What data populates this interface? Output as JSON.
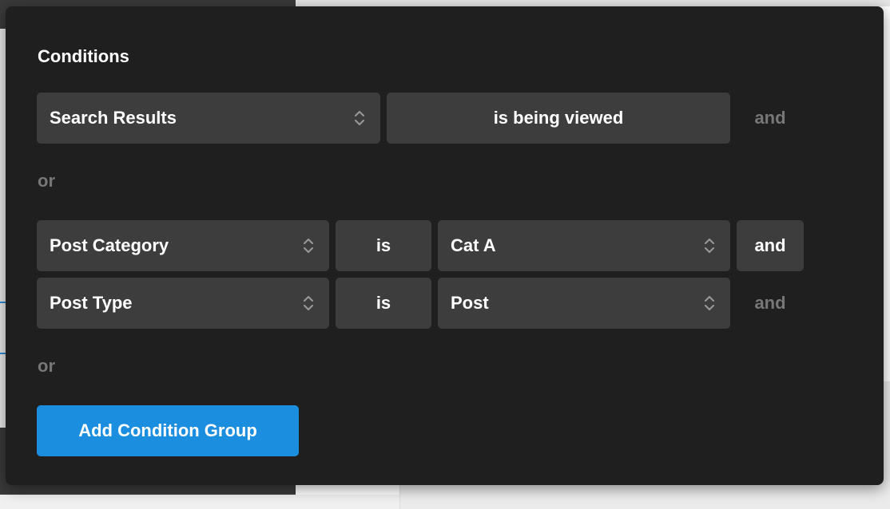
{
  "modal": {
    "title": "Conditions"
  },
  "groups": [
    {
      "rows": [
        {
          "subject": "Search Results",
          "operator": "is being viewed",
          "connector": "and",
          "connector_active": false
        }
      ]
    },
    {
      "rows": [
        {
          "subject": "Post Category",
          "operator": "is",
          "value": "Cat A",
          "connector": "and",
          "connector_active": true
        },
        {
          "subject": "Post Type",
          "operator": "is",
          "value": "Post",
          "connector": "and",
          "connector_active": false
        }
      ]
    }
  ],
  "separators": {
    "or_1": "or",
    "or_2": "or"
  },
  "actions": {
    "add_condition_group": "Add Condition Group"
  },
  "icons": {
    "select_chevron": "chevron-up-down-icon"
  },
  "colors": {
    "modal_bg": "#1f1f1f",
    "control_bg": "#3d3d3d",
    "muted_text": "#777777",
    "primary_button": "#1c8ee0"
  }
}
